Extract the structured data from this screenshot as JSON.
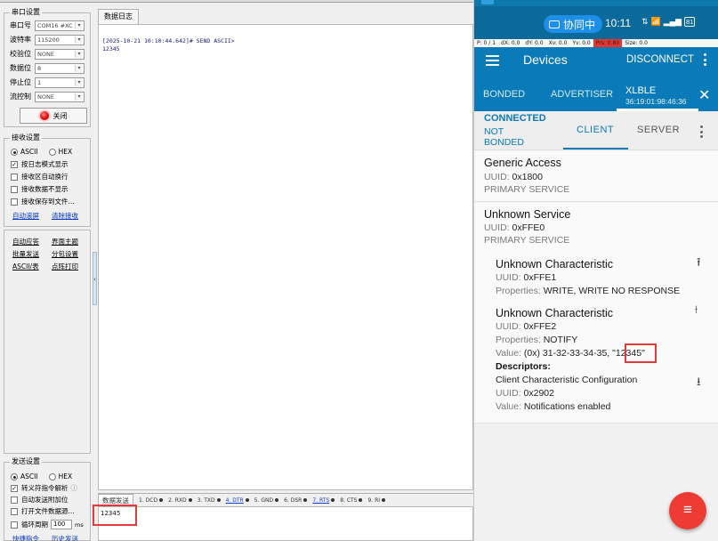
{
  "serial_port_settings": {
    "title": "串口设置",
    "fields": [
      {
        "label": "串口号",
        "value": "COM16 #XC"
      },
      {
        "label": "波特率",
        "value": "115200"
      },
      {
        "label": "校验位",
        "value": "NONE"
      },
      {
        "label": "数据位",
        "value": "8"
      },
      {
        "label": "停止位",
        "value": "1"
      },
      {
        "label": "流控制",
        "value": "NONE"
      }
    ],
    "open_button_label": "关闭"
  },
  "receive_settings": {
    "title": "接收设置",
    "mode_ascii": "ASCII",
    "mode_hex": "HEX",
    "options": [
      {
        "label": "按日志模式显示",
        "checked": true
      },
      {
        "label": "接收区自动换行",
        "checked": false
      },
      {
        "label": "接收数据不显示",
        "checked": false
      },
      {
        "label": "接收保存到文件...",
        "checked": false
      }
    ],
    "auto_scroll_link": "自动滚屏",
    "clear_link": "清除接收"
  },
  "tools": {
    "auto_reply": "自动应答",
    "theme": "界面主题",
    "batch_send": "批量发送",
    "split_display": "分包设置",
    "ascii_table": "ASCII/表",
    "dot_print": "点阵打印"
  },
  "send_settings": {
    "title": "发送设置",
    "mode_ascii": "ASCII",
    "mode_hex": "HEX",
    "options": [
      {
        "label": "转义符指令解析",
        "checked": true
      },
      {
        "label": "自动发送附加位",
        "checked": false
      },
      {
        "label": "打开文件数据源...",
        "checked": false
      },
      {
        "label": "循环周期",
        "checked": false
      }
    ],
    "period_value": "100",
    "period_unit": "ms",
    "quick_cmd": "快捷指令",
    "history": "历史发送"
  },
  "log": {
    "tab_label": "数据日志",
    "lines": [
      "[2025-10-21 10:10:44.642]# SEND ASCII>",
      "12345"
    ]
  },
  "send": {
    "tab_label": "数据发送",
    "signals": [
      {
        "label": "1. DCD",
        "link": false
      },
      {
        "label": "2. RXD",
        "link": false
      },
      {
        "label": "3. TXD",
        "link": false
      },
      {
        "label": "4. DTR",
        "link": true
      },
      {
        "label": "5. GND",
        "link": false
      },
      {
        "label": "6. DSR",
        "link": false
      },
      {
        "label": "7. RTS",
        "link": true
      },
      {
        "label": "8. CTS",
        "link": false
      },
      {
        "label": "9. RI",
        "link": false
      }
    ],
    "text": "12345"
  },
  "phone": {
    "status": {
      "pill": "协同中",
      "time": "10:11",
      "battery": "81"
    },
    "pointer": {
      "p": "P: 0 / 1",
      "dx": "dX: 0.0",
      "dy": "dY: 0.0",
      "xv": "Xv: 0.0",
      "yv": "Yv: 0.0",
      "prs": "Prs: 0.80",
      "size": "Size: 0.0"
    },
    "appbar": {
      "title": "Devices",
      "disconnect": "DISCONNECT"
    },
    "tabs": {
      "bonded": "BONDED",
      "advertiser": "ADVERTISER",
      "device_name": "XLBLE",
      "device_mac": "36:19:01:98:46:36"
    },
    "connection": {
      "status": "CONNECTED",
      "bond_line1": "NOT",
      "bond_line2": "BONDED",
      "client": "CLIENT",
      "server": "SERVER"
    },
    "services": [
      {
        "name": "Generic Access",
        "uuid_label": "UUID:",
        "uuid": "0x1800",
        "type": "PRIMARY SERVICE"
      },
      {
        "name": "Unknown Service",
        "uuid_label": "UUID:",
        "uuid": "0xFFE0",
        "type": "PRIMARY SERVICE"
      }
    ],
    "characteristics": [
      {
        "name": "Unknown Characteristic",
        "uuid_label": "UUID:",
        "uuid": "0xFFE1",
        "props_label": "Properties:",
        "props": "WRITE, WRITE NO RESPONSE"
      },
      {
        "name": "Unknown Characteristic",
        "uuid_label": "UUID:",
        "uuid": "0xFFE2",
        "props_label": "Properties:",
        "props": "NOTIFY",
        "value_label": "Value:",
        "value_hex": "(0x) 31-32-33-34-35, \"",
        "value_text": "12345\""
      }
    ],
    "descriptors": {
      "title": "Descriptors:",
      "name": "Client Characteristic Configuration",
      "uuid_label": "UUID:",
      "uuid": "0x2902",
      "value_label": "Value:",
      "value": "Notifications enabled"
    }
  },
  "colors": {
    "accent": "#0a7ab8",
    "fab": "#ee3b34",
    "highlight": "#e23a3a"
  }
}
